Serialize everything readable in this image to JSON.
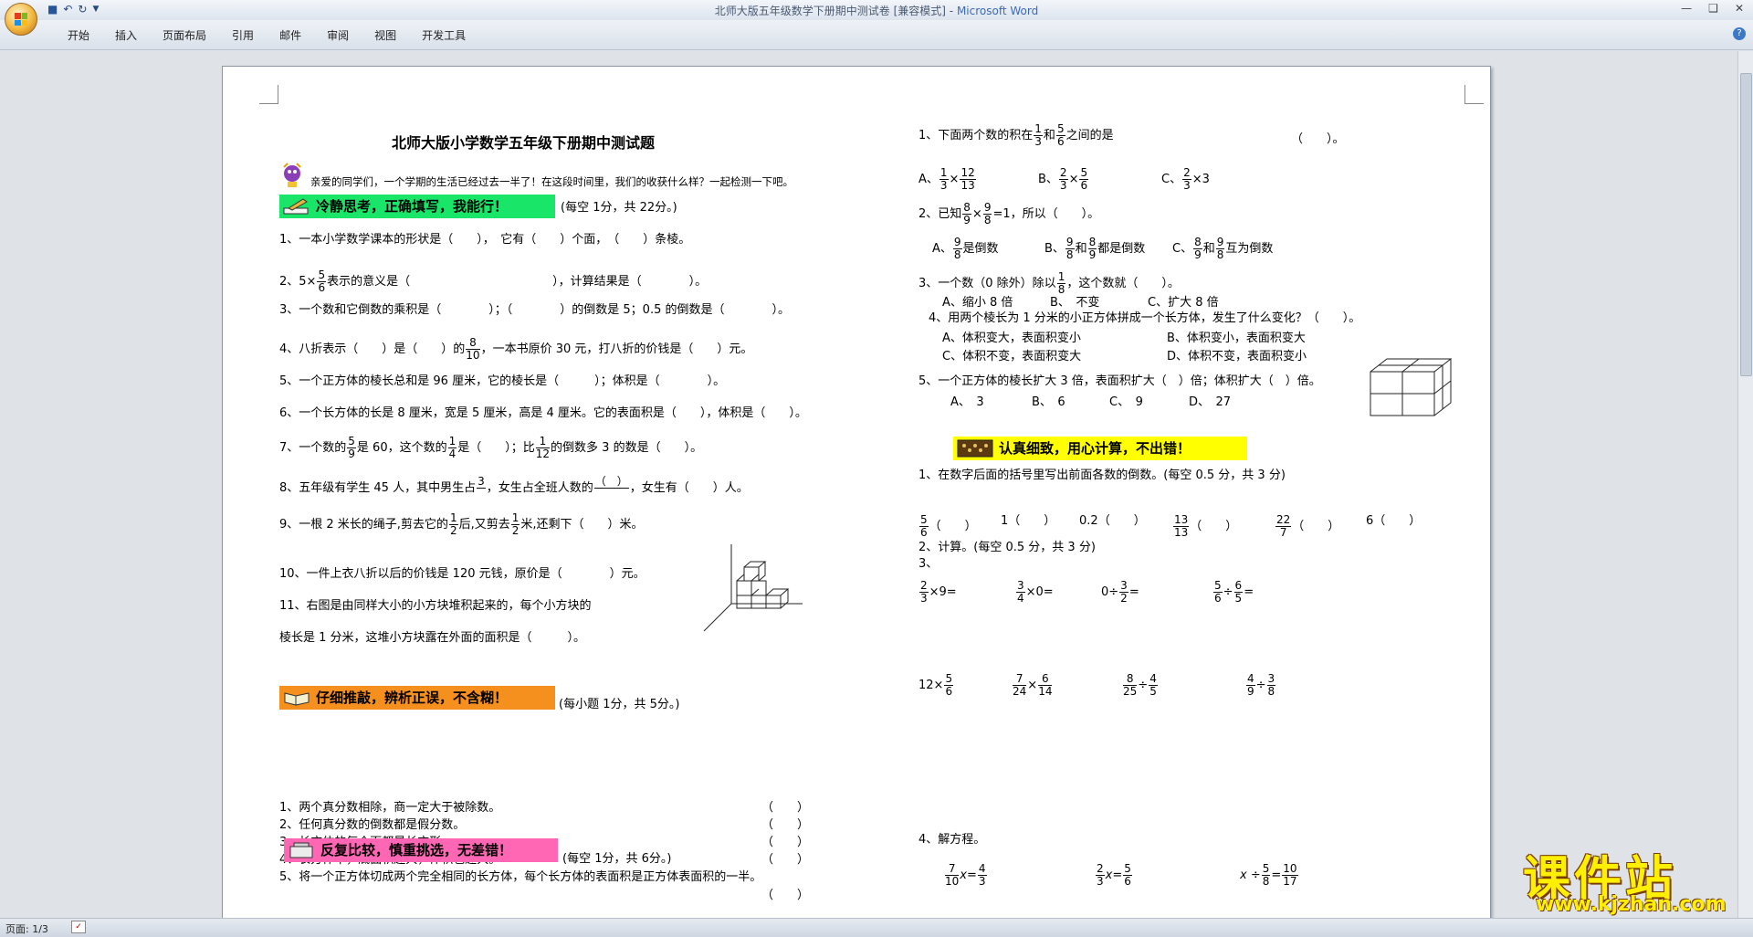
{
  "window": {
    "title_doc": "北师大版五年级数学下册期中测试卷 [兼容模式]",
    "title_sep": " - ",
    "title_app": "Microsoft Word"
  },
  "ribbon": {
    "tabs": [
      "开始",
      "插入",
      "页面布局",
      "引用",
      "邮件",
      "审阅",
      "视图",
      "开发工具"
    ]
  },
  "status": {
    "page": "页面: 1/3"
  },
  "watermark": {
    "main": "课件站",
    "url": "www.kjzhan.com"
  },
  "left": {
    "title": "北师大版小学数学五年级下册期中测试题",
    "intro": "亲爱的同学们，一个学期的生活已经过去一半了！在这段时间里，我们的收获什么样？一起检测一下吧。",
    "sec1": {
      "label": "冷静思考，正确填写，我能行！",
      "note": "(每空 1分，共 22分。)"
    },
    "q1": "1、一本小学数学课本的形状是（　　），　它有（　　）个面，　（　　）条棱。",
    "q2a": "2、5×",
    "q2n": "5",
    "q2d": "6",
    "q2b": "表示的意义是（　　　　　　　　　　　　），计算结果是（　　　　）。",
    "q3": "3、一个数和它倒数的乘积是（　　　　）；（　　　　）的倒数是 5；0.5 的倒数是（　　　　）。",
    "q4a": "4、八折表示（　　）是（　　）的",
    "q4n": "8",
    "q4d": "10",
    "q4b": "，一本书原价 30 元，打八折的价钱是（　　）元。",
    "q5": "5、一个正方体的棱长总和是 96 厘米，它的棱长是（　　　）；体积是（　　　　）。",
    "q6": "6、一个长方体的长是 8 厘米，宽是 5 厘米，高是 4 厘米。它的表面积是（　　），体积是（　　）。",
    "q7a": "7、一个数的",
    "q7n1": "5",
    "q7d1": "9",
    "q7b": "是 60，这个数的",
    "q7n2": "1",
    "q7d2": "4",
    "q7c": "是（　　）；比",
    "q7n3": "1",
    "q7d3": "12",
    "q7e": "的倒数多 3 的数是（　　）。",
    "q8a": "8、五年级有学生 45 人，其中男生占",
    "q8n": "3",
    "q8d": "",
    "q8b": "，女生占全班人数的",
    "q8n2": "（　）",
    "q8d2": "",
    "q8c": "，女生有（　　）人。",
    "q9a": "9、一根 2 米长的绳子,剪去它的",
    "q9n": "1",
    "q9d": "2",
    "q9b": "后,又剪去",
    "q9n2": "1",
    "q9d2": "2",
    "q9c": "米,还剩下（　　）米。",
    "q10": "10、一件上衣八折以后的价钱是 120 元钱，原价是（　　　　）元。",
    "q11a": "11、右图是由同样大小的小方块堆积起来的，每个小方块的",
    "q11b": "棱长是 1 分米，这堆小方块露在外面的面积是（　　　）。",
    "sec2": {
      "label": "仔细推敲，辨析正误，不含糊！",
      "note": "(每小题 1分，共 5分。)"
    },
    "j": [
      {
        "t": "1、两个真分数相除，商一定大于被除数。",
        "b": "（　　）"
      },
      {
        "t": "2、任何真分数的倒数都是假分数。",
        "b": "（　　）"
      },
      {
        "t": "3、长方体的每个面都是长方形。",
        "b": "（　　）"
      },
      {
        "t": "4、长方体中，底面积越大，体积也越大。",
        "b": "（　　）"
      },
      {
        "t": "5、将一个正方体切成两个完全相同的长方体，每个长方体的表面积是正方体表面积的一半。",
        "b": "（　　）"
      }
    ],
    "sec3": {
      "label": "反复比较，慎重挑选，无差错！",
      "note": "(每空 1分，共 6分。)"
    }
  },
  "right": {
    "c1a": "1、下面两个数的积在",
    "c1n1": "1",
    "c1d1": "3",
    "c1b": "和",
    "c1n2": "5",
    "c1d2": "6",
    "c1c": "之间的是",
    "c1p": "（　　）。",
    "c1A": "A、",
    "c1An1": "1",
    "c1Ad1": "3",
    "c1An2": "12",
    "c1Ad2": "13",
    "c1B": "B、",
    "c1Bn1": "2",
    "c1Bd1": "3",
    "c1Bn2": "5",
    "c1Bd2": "6",
    "c1C": "C、",
    "c1Cn": "2",
    "c1Cd": "3",
    "c1Ce": "×3",
    "times": "×",
    "c2a": "2、已知",
    "c2n1": "8",
    "c2d1": "9",
    "c2n2": "9",
    "c2d2": "8",
    "c2b": "=1，所以（　　）。",
    "c2A": "A、",
    "c2An": "9",
    "c2Ad": "8",
    "c2At": "是倒数",
    "c2B": "B、",
    "c2Bn1": "9",
    "c2Bd1": "8",
    "c2Bm": "和",
    "c2Bn2": "8",
    "c2Bd2": "9",
    "c2Bt": "都是倒数",
    "c2C": "C、",
    "c2Cn1": "8",
    "c2Cd1": "9",
    "c2Cm": "和",
    "c2Cn2": "9",
    "c2Cd2": "8",
    "c2Ct": "互为倒数",
    "c3a": "3、一个数（0 除外）除以",
    "c3n": "1",
    "c3d": "8",
    "c3b": "，这个数就（　　）。",
    "c3o": [
      "A、缩小 8 倍",
      "B、　不变",
      "C、扩大 8 倍"
    ],
    "c4": "4、用两个棱长为 1 分米的小正方体拼成一个长方体，发生了什么变化？（　　）。",
    "c4o": [
      "A、体积变大，表面积变小",
      "B、体积变小，表面积变大",
      "C、体积不变，表面积变大",
      "D、体积不变，表面积变小"
    ],
    "c5": "5、一个正方体的棱长扩大 3 倍，表面积扩大（　）倍；体积扩大（　）倍。",
    "c5o": [
      "A、　3",
      "B、　6",
      "C、　9",
      "D、　27"
    ],
    "sec4": {
      "label": "认真细致，用心计算，不出错！"
    },
    "k1": "1、在数字后面的括号里写出前面各数的倒数。(每空 0.5 分，共 3 分)",
    "k1p": "（　　）",
    "k1i": [
      {
        "n": "5",
        "d": "6"
      },
      {
        "t": "1"
      },
      {
        "t": "0.2"
      },
      {
        "n": "13",
        "d": "13"
      },
      {
        "n": "22",
        "d": "7"
      },
      {
        "t": "6"
      }
    ],
    "k2": "2、计算。(每空 0.5 分，共 3 分)",
    "k3": "3、",
    "e1": "×9=",
    "e2": "×0=",
    "e3a": "0÷",
    "e3b": "=",
    "e4a": "÷",
    "e4b": "=",
    "f1": "12×",
    "f2": "×",
    "f3": "÷",
    "f4": "÷",
    "k4": "4、解方程。",
    "g1": "x=",
    "g2": "x=",
    "g3a": "x ÷",
    "g3b": "="
  }
}
